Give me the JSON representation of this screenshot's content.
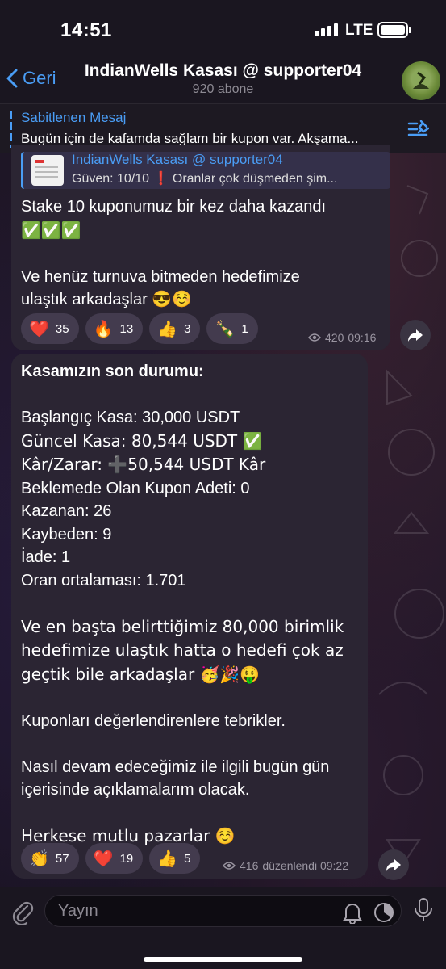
{
  "status_bar": {
    "time": "14:51",
    "network": "LTE"
  },
  "header": {
    "back_label": "Geri",
    "title": "IndianWells Kasası @ supporter04",
    "subtitle": "920 abone"
  },
  "pinned": {
    "title": "Sabitlenen Mesaj",
    "text": "Bugün için de kafamda sağlam bir kupon var. Akşama..."
  },
  "message1": {
    "reply": {
      "name": "IndianWells Kasası @ supporter04",
      "text": "Güven: 10/10 ❗ Oranlar çok düşmeden şim..."
    },
    "line1": "Stake 10 kuponumuz bir kez daha kazandı",
    "checks": "✅✅✅",
    "line2": "Ve henüz turnuva bitmeden hedefimize",
    "line3": "ulaştık arkadaşlar 😎☺️",
    "reactions": [
      {
        "emoji": "❤️",
        "count": "35"
      },
      {
        "emoji": "🔥",
        "count": "13"
      },
      {
        "emoji": "👍",
        "count": "3"
      },
      {
        "emoji": "🍾",
        "count": "1"
      }
    ],
    "views": "420",
    "time": "09:16"
  },
  "message2": {
    "heading": "Kasamızın son durumu:",
    "lines": [
      "Başlangıç Kasa: 30,000 USDT",
      "Güncel Kasa: 80,544 USDT ✅",
      "Kâr/Zarar: ➕50,544 USDT Kâr",
      "Beklemede Olan Kupon Adeti: 0",
      "Kazanan: 26",
      "Kaybeden: 9",
      "İade: 1",
      "Oran ortalaması: 1.701"
    ],
    "para1": "Ve en başta belirttiğimiz 80,000 birimlik hedefimize ulaştık hatta o hedefi çok az geçtik bile arkadaşlar 🥳🎉🤑",
    "para2": "Kuponları değerlendirenlere tebrikler.",
    "para3": "Nasıl devam edeceğimiz ile ilgili bugün gün içerisinde açıklamalarım olacak.",
    "para4": "Herkese mutlu pazarlar ☺️",
    "reactions": [
      {
        "emoji": "👏",
        "count": "57"
      },
      {
        "emoji": "❤️",
        "count": "19"
      },
      {
        "emoji": "👍",
        "count": "5"
      }
    ],
    "views": "416",
    "edited_time": "düzenlendi 09:22"
  },
  "input": {
    "placeholder": "Yayın"
  },
  "colors": {
    "accent": "#4a9df5",
    "bubble": "#2b2533",
    "check_green": "#2fbe4a"
  }
}
